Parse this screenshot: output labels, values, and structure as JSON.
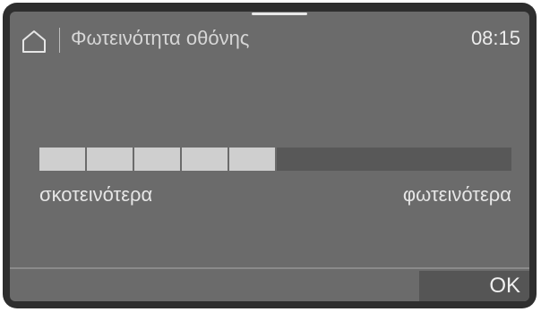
{
  "header": {
    "home_icon": "home-icon",
    "title": "Φωτεινότητα οθόνης",
    "time": "08:15"
  },
  "brightness": {
    "level": 5,
    "max_level": 10,
    "label_min": "σκοτεινότερα",
    "label_max": "φωτεινότερα"
  },
  "footer": {
    "ok_label": "OK"
  },
  "colors": {
    "screen_bg": "#6b6b6b",
    "segment_on": "#cfcfcf",
    "segment_off": "#585858",
    "bezel": "#2e2e2e"
  }
}
